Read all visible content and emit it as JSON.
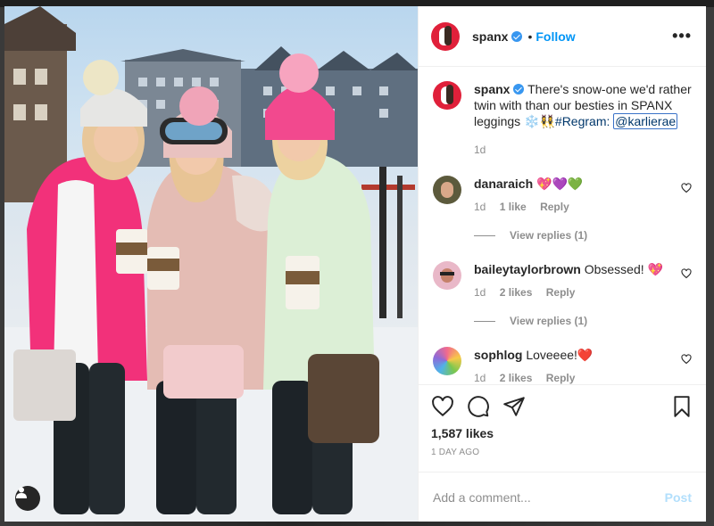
{
  "post": {
    "username": "spanx",
    "follow_label": "Follow",
    "dot": "•",
    "more_label": "•••",
    "caption": {
      "username": "spanx",
      "text": " There's snow-one we'd rather twin with than our besties in SPANX leggings ❄️👯‍♀️",
      "hashtag": "#Regram:",
      "mention": "@karlierae",
      "time": "1d"
    },
    "likes": "1,587 likes",
    "time_ago": "1 DAY AGO",
    "add_comment_placeholder": "Add a comment...",
    "post_label": "Post"
  },
  "comments": [
    {
      "username": "danaraich",
      "text": " 💖💜💚",
      "time": "1d",
      "likes": "1 like",
      "reply": "Reply",
      "view_replies": "View replies (1)",
      "avatar_color": "#5c5a3c"
    },
    {
      "username": "baileytaylorbrown",
      "text": " Obsessed! 💖",
      "time": "1d",
      "likes": "2 likes",
      "reply": "Reply",
      "view_replies": "View replies (1)",
      "avatar_color": "#e9b8c8"
    },
    {
      "username": "sophlog",
      "text": " Loveeee!❤️",
      "time": "1d",
      "likes": "2 likes",
      "reply": "Reply",
      "avatar_color": "#7ab7e0"
    }
  ],
  "colors": {
    "accent": "#0095f6",
    "verified": "#3897f0",
    "brand_red": "#e0203a"
  }
}
